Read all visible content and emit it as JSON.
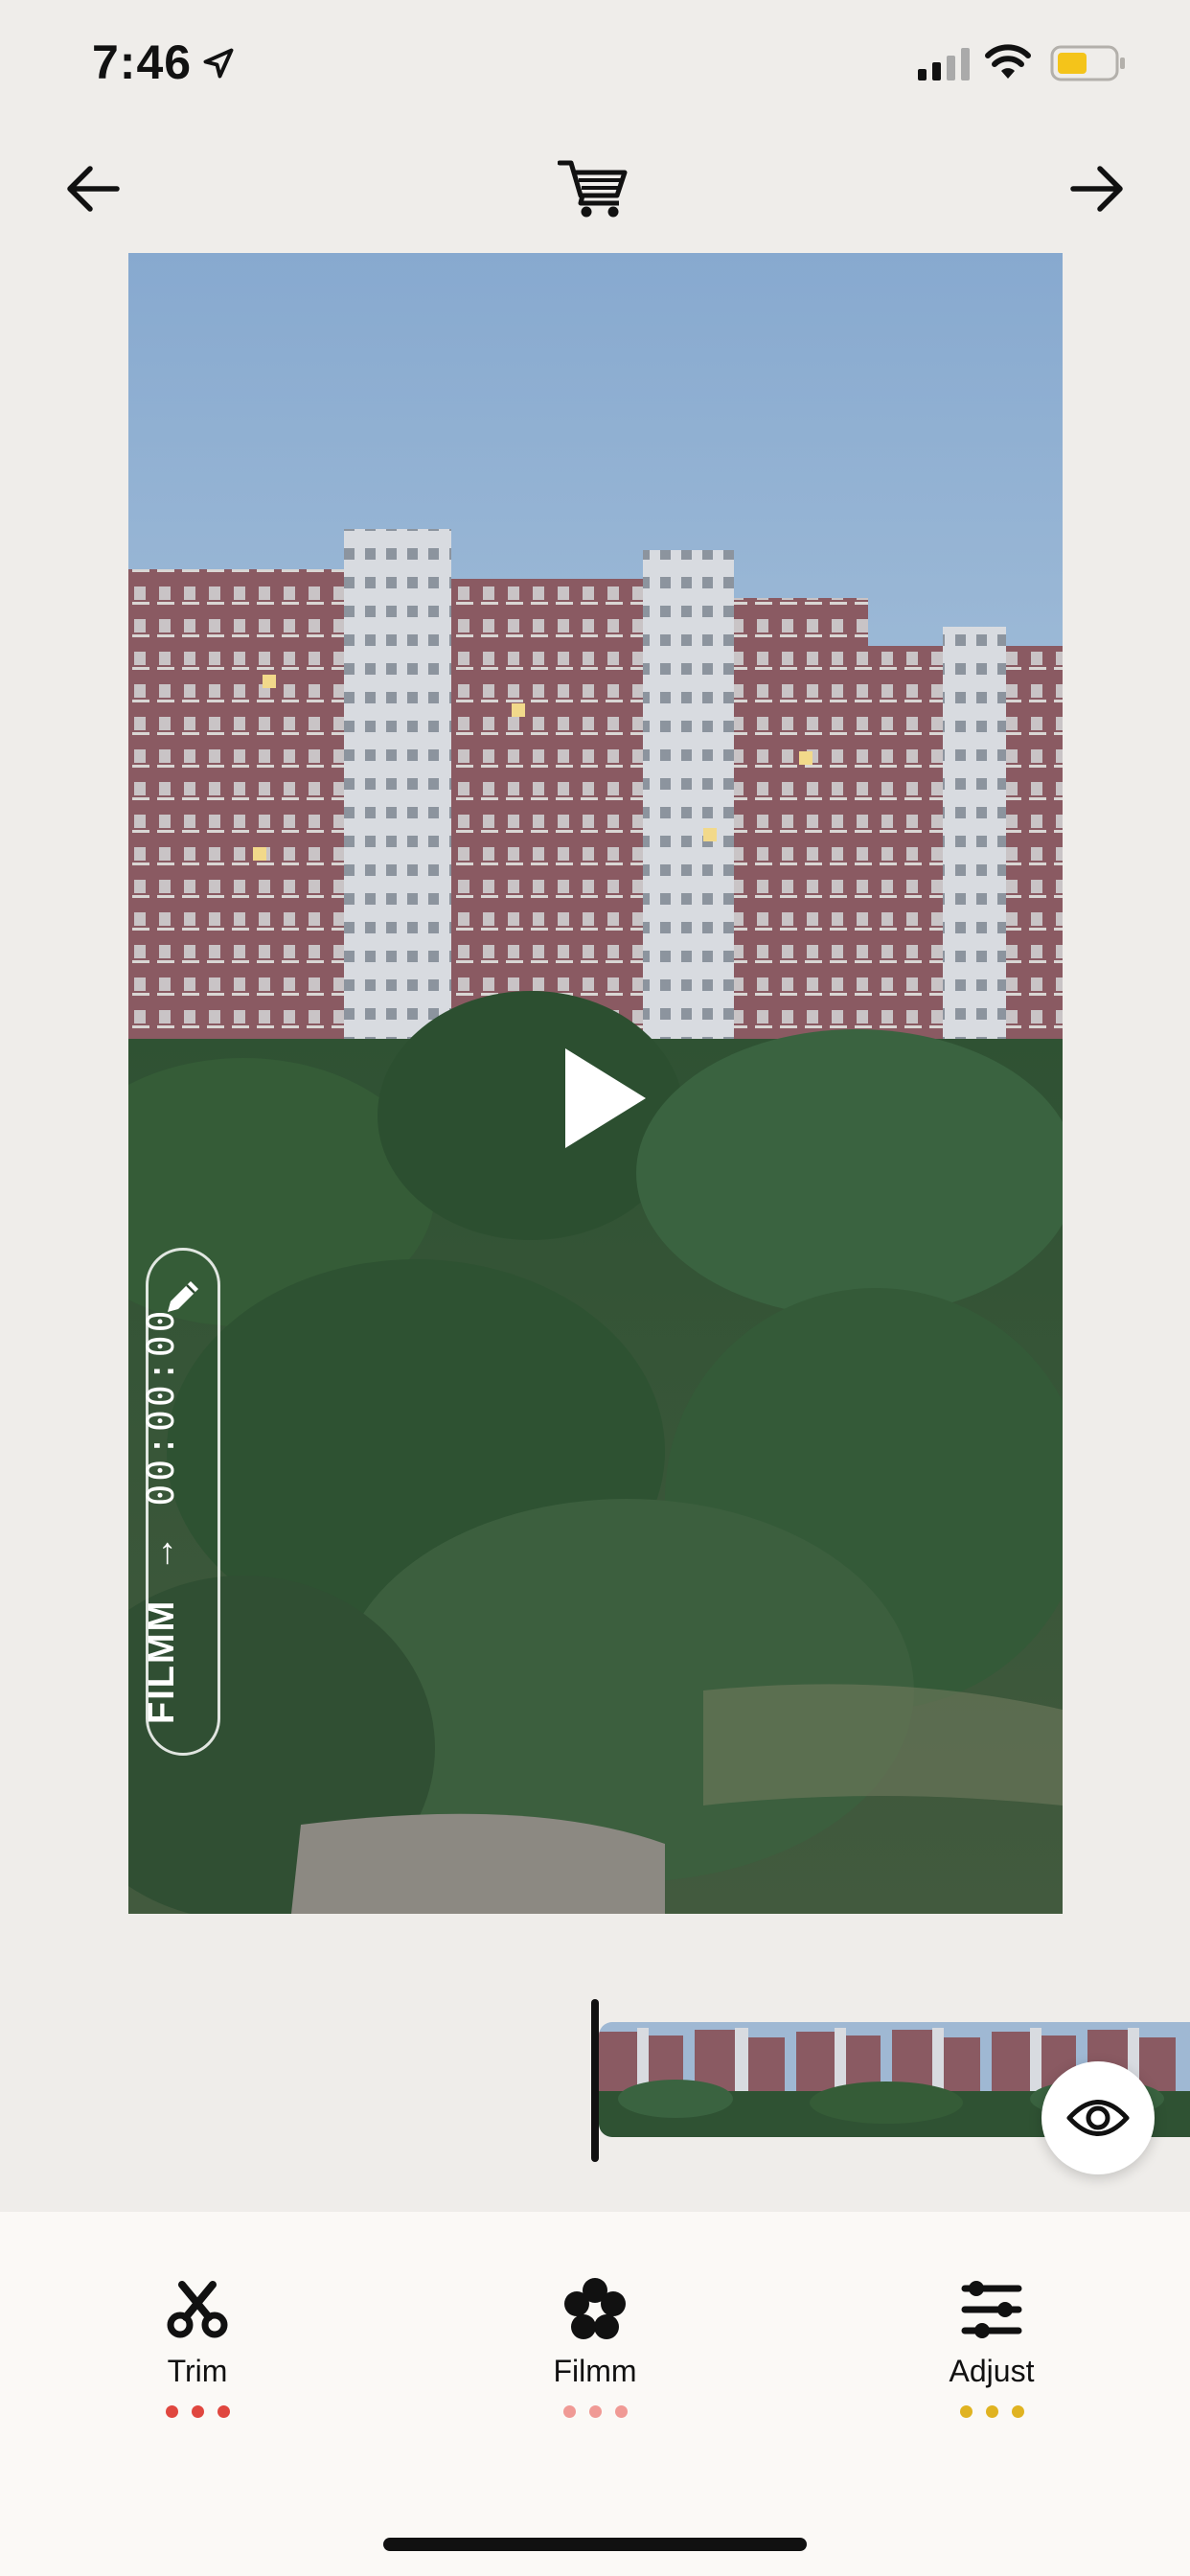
{
  "status": {
    "time": "7:46",
    "battery_color": "#f4c41a"
  },
  "nav": {
    "back_icon": "arrow-left-icon",
    "cart_icon": "cart-icon",
    "forward_icon": "arrow-right-icon"
  },
  "preview": {
    "overlay_brand": "FILMM",
    "overlay_arrow": "→",
    "overlay_timecode": "00:00:00"
  },
  "tabs": [
    {
      "label": "Trim",
      "icon": "scissors-icon",
      "dot_color": "#e0473f"
    },
    {
      "label": "Filmm",
      "icon": "flower-icon",
      "dot_color": "#f09a95"
    },
    {
      "label": "Adjust",
      "icon": "sliders-icon",
      "dot_color": "#e0b321"
    }
  ]
}
